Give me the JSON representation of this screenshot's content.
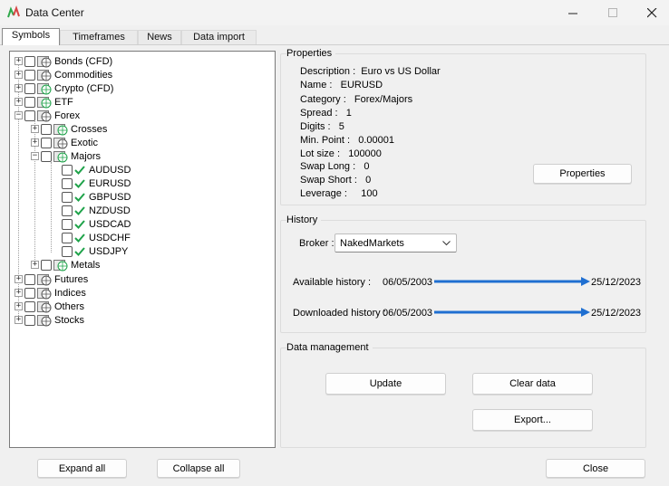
{
  "window": {
    "title": "Data Center"
  },
  "tabs": [
    {
      "label": "Symbols",
      "active": true
    },
    {
      "label": "Timeframes",
      "active": false
    },
    {
      "label": "News",
      "active": false
    },
    {
      "label": "Data import",
      "active": false
    }
  ],
  "tree": {
    "bonds": "Bonds (CFD)",
    "commodities": "Commodities",
    "crypto": "Crypto (CFD)",
    "etf": "ETF",
    "forex": "Forex",
    "crosses": "Crosses",
    "exotic": "Exotic",
    "majors": "Majors",
    "pairs": [
      "AUDUSD",
      "EURUSD",
      "GBPUSD",
      "NZDUSD",
      "USDCAD",
      "USDCHF",
      "USDJPY"
    ],
    "metals": "Metals",
    "futures": "Futures",
    "indices": "Indices",
    "others": "Others",
    "stocks": "Stocks"
  },
  "properties": {
    "group_title": "Properties",
    "rows": [
      {
        "label": "Description :",
        "value": "Euro vs US Dollar"
      },
      {
        "label": "Name :",
        "value": "EURUSD"
      },
      {
        "label": "Category :",
        "value": "Forex/Majors"
      },
      {
        "label": "Spread :",
        "value": "1"
      },
      {
        "label": "Digits :",
        "value": "5"
      },
      {
        "label": "Min. Point :",
        "value": "0.00001"
      },
      {
        "label": "Lot size :",
        "value": "100000"
      },
      {
        "label": "Swap Long :",
        "value": "0"
      },
      {
        "label": "Swap Short :",
        "value": "0"
      },
      {
        "label": "Leverage :",
        "value": "100"
      }
    ],
    "button_label": "Properties"
  },
  "history": {
    "group_title": "History",
    "broker_label": "Broker :",
    "broker_value": "NakedMarkets",
    "available_label": "Available history :",
    "available_from": "06/05/2003",
    "available_to": "25/12/2023",
    "downloaded_label": "Downloaded history :",
    "downloaded_from": "06/05/2003",
    "downloaded_to": "25/12/2023"
  },
  "data_management": {
    "group_title": "Data management",
    "update_label": "Update",
    "clear_label": "Clear data",
    "export_label": "Export..."
  },
  "footer": {
    "expand_label": "Expand all",
    "collapse_label": "Collapse all",
    "close_label": "Close"
  },
  "colors": {
    "arrow": "#1f6fd1",
    "check": "#1fa34a",
    "app_icon_red": "#d64545",
    "app_icon_green": "#2ea84a"
  }
}
